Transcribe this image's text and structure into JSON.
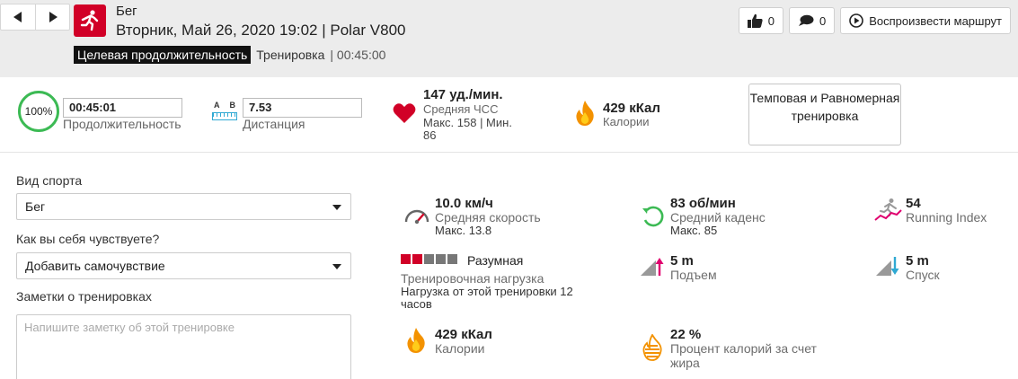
{
  "header": {
    "title": "Бег",
    "subtitle": "Вторник, Май 26, 2020 19:02 | Polar V800",
    "tag_target": "Целевая продолжительность",
    "tag_type": "Тренировка",
    "tag_duration": "| 00:45:00",
    "accent": "#d10027"
  },
  "actions": {
    "likes": "0",
    "comments": "0",
    "replay": "Воспроизвести маршрут"
  },
  "summary": {
    "percent": "100%",
    "duration_value": "00:45:01",
    "duration_label": "Продолжительность",
    "distance_a": "A",
    "distance_b": "B",
    "distance_value": "7.53",
    "distance_label": "Дистанция",
    "hr_value": "147 уд./мин.",
    "hr_label": "Средняя ЧСС",
    "hr_minmax_line1": "Макс. 158  |  Мин.",
    "hr_minmax_line2": "86",
    "calories_value": "429 кКал",
    "calories_label": "Калории",
    "tempo_button": "Темповая и Равномерная тренировка"
  },
  "form": {
    "sport_label": "Вид спорта",
    "sport_value": "Бег",
    "feeling_label": "Как вы себя чувствуете?",
    "feeling_value": "Добавить самочувствие",
    "notes_label": "Заметки о тренировках",
    "notes_placeholder": "Напишите заметку об этой тренировке"
  },
  "stats": {
    "speed": {
      "value": "10.0 км/ч",
      "label": "Средняя скорость",
      "sub": "Макс. 13.8"
    },
    "cadence": {
      "value": "83 об/мин",
      "label": "Средний каденс",
      "sub": "Макс. 85"
    },
    "running_index": {
      "value": "54",
      "label": "Running Index"
    },
    "load": {
      "value": "Разумная",
      "label": "Тренировочная нагрузка",
      "sub": "Нагрузка от этой тренировки 12 часов",
      "level": 2,
      "of": 5
    },
    "ascent": {
      "value": "5 m",
      "label": "Подъем"
    },
    "descent": {
      "value": "5 m",
      "label": "Спуск"
    },
    "calories": {
      "value": "429 кКал",
      "label": "Калории"
    },
    "fat": {
      "value": "22 %",
      "label": "Процент калорий за счет жира"
    }
  }
}
